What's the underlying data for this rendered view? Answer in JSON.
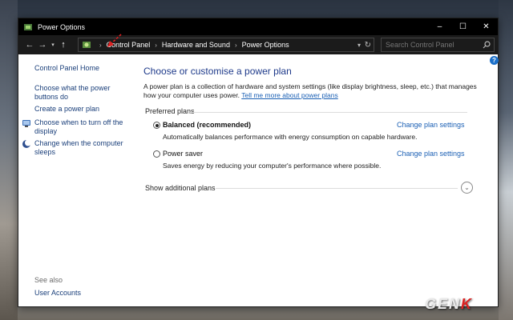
{
  "window": {
    "title": "Power Options",
    "controls": {
      "minimize": "–",
      "maximize": "☐",
      "close": "✕"
    }
  },
  "address": {
    "crumbs": [
      "Control Panel",
      "Hardware and Sound",
      "Power Options"
    ],
    "search_placeholder": "Search Control Panel"
  },
  "sidebar": {
    "home": "Control Panel Home",
    "items": [
      {
        "label": "Choose what the power buttons do"
      },
      {
        "label": "Create a power plan"
      },
      {
        "label": "Choose when to turn off the display"
      },
      {
        "label": "Change when the computer sleeps"
      }
    ],
    "see_also": "See also",
    "user_accounts": "User Accounts"
  },
  "main": {
    "title": "Choose or customise a power plan",
    "description": "A power plan is a collection of hardware and system settings (like display brightness, sleep, etc.) that manages how your computer uses power.",
    "link": "Tell me more about power plans",
    "preferred_label": "Preferred plans",
    "plans": [
      {
        "name": "Balanced (recommended)",
        "selected": true,
        "description": "Automatically balances performance with energy consumption on capable hardware.",
        "change": "Change plan settings"
      },
      {
        "name": "Power saver",
        "selected": false,
        "description": "Saves energy by reducing your computer's performance where possible.",
        "change": "Change plan settings"
      }
    ],
    "show_additional": "Show additional plans"
  },
  "help": "?",
  "watermark": {
    "main": "GEN",
    "accent": "K"
  },
  "colors": {
    "link": "#1a5fb4",
    "title": "#1e3a8a",
    "annotation": "#e02020"
  }
}
